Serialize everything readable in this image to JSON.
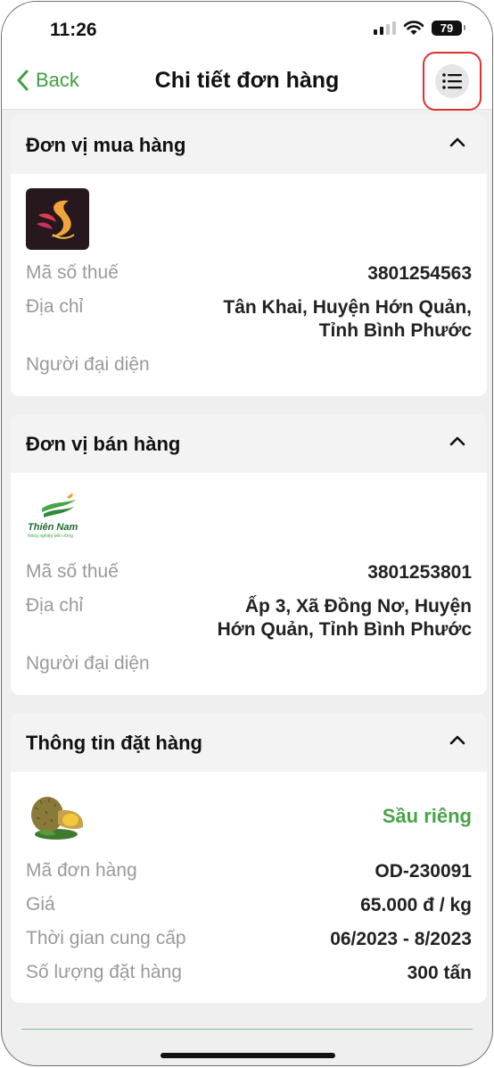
{
  "status_bar": {
    "time": "11:26",
    "battery": "79"
  },
  "nav": {
    "back_label": "Back",
    "title": "Chi tiết đơn hàng"
  },
  "buyer": {
    "title": "Đơn vị mua hàng",
    "tax_label": "Mã số thuế",
    "tax_value": "3801254563",
    "address_label": "Địa chỉ",
    "address_line1": "Tân Khai, Huyện Hớn Quản,",
    "address_line2": "Tỉnh Bình Phước",
    "rep_label": "Người đại diện"
  },
  "seller": {
    "title": "Đơn vị bán hàng",
    "logo_text": "Thiên Nam",
    "logo_tagline": "Nông nghiệp bền vững",
    "tax_label": "Mã số thuế",
    "tax_value": "3801253801",
    "address_label": "Địa chỉ",
    "address_line1": "Ấp 3, Xã Đồng Nơ, Huyện",
    "address_line2": "Hớn Quản, Tỉnh Bình Phước",
    "rep_label": "Người đại diện"
  },
  "order": {
    "title": "Thông tin đặt hàng",
    "product_name": "Sầu riêng",
    "rows": [
      {
        "label": "Mã đơn hàng",
        "value": "OD-230091"
      },
      {
        "label": "Giá",
        "value": "65.000 đ / kg"
      },
      {
        "label": "Thời gian cung cấp",
        "value": "06/2023 - 8/2023"
      },
      {
        "label": "Số lượng đặt hàng",
        "value": "300 tấn"
      }
    ]
  },
  "colors": {
    "accent": "#3f9f3f",
    "highlight_border": "#e03030",
    "background": "#efeff0"
  },
  "icons": [
    "chevron-left-icon",
    "list-icon",
    "chevron-up-icon",
    "wifi-icon",
    "signal-icon",
    "battery-icon"
  ]
}
